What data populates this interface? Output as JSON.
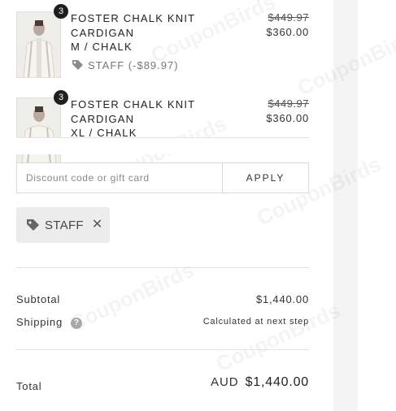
{
  "items": [
    {
      "name": "FOSTER CHALK KNIT CARDIGAN",
      "variant": "M / CHALK",
      "quantity": "3",
      "price_original": "$449.97",
      "price_final": "$360.00",
      "discount_text": "STAFF (-$89.97)"
    },
    {
      "name": "FOSTER CHALK KNIT CARDIGAN",
      "variant": "XL / CHALK",
      "quantity": "3",
      "price_original": "$449.97",
      "price_final": "$360.00"
    }
  ],
  "discount": {
    "placeholder": "Discount code or gift card",
    "apply_label": "APPLY",
    "applied_code": "STAFF"
  },
  "summary": {
    "subtotal_label": "Subtotal",
    "subtotal_value": "$1,440.00",
    "shipping_label": "Shipping",
    "shipping_value": "Calculated at next step",
    "total_label": "Total",
    "currency": "AUD",
    "total_value": "$1,440.00"
  },
  "watermark": "CouponBirds",
  "colors": {
    "badge_bg": "#1f1f1f",
    "chip_bg": "#ececec",
    "side_panel": "#f4f4f5"
  }
}
